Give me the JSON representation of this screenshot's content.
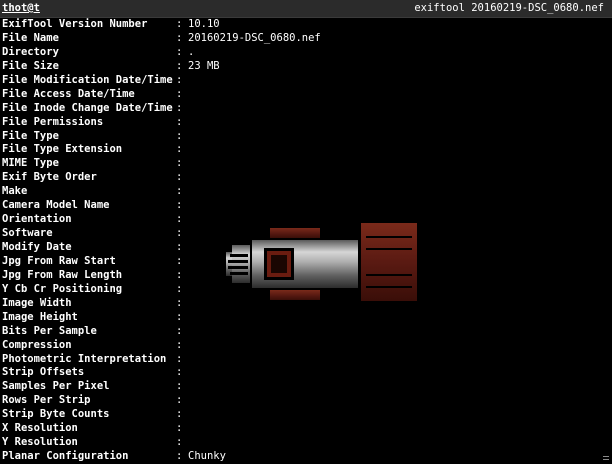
{
  "window": {
    "tab_label": "thot@t",
    "title": "exiftool 20160219-DSC_0680.nef"
  },
  "separator": ":",
  "rows": [
    {
      "key": "ExifTool Version Number",
      "value": "10.10"
    },
    {
      "key": "File Name",
      "value": "20160219-DSC_0680.nef"
    },
    {
      "key": "Directory",
      "value": "."
    },
    {
      "key": "File Size",
      "value": "23 MB"
    },
    {
      "key": "File Modification Date/Time",
      "value": ""
    },
    {
      "key": "File Access Date/Time",
      "value": ""
    },
    {
      "key": "File Inode Change Date/Time",
      "value": ""
    },
    {
      "key": "File Permissions",
      "value": ""
    },
    {
      "key": "File Type",
      "value": ""
    },
    {
      "key": "File Type Extension",
      "value": ""
    },
    {
      "key": "MIME Type",
      "value": ""
    },
    {
      "key": "Exif Byte Order",
      "value": ""
    },
    {
      "key": "Make",
      "value": ""
    },
    {
      "key": "Camera Model Name",
      "value": ""
    },
    {
      "key": "Orientation",
      "value": ""
    },
    {
      "key": "Software",
      "value": ""
    },
    {
      "key": "Modify Date",
      "value": ""
    },
    {
      "key": "Jpg From Raw Start",
      "value": ""
    },
    {
      "key": "Jpg From Raw Length",
      "value": ""
    },
    {
      "key": "Y Cb Cr Positioning",
      "value": ""
    },
    {
      "key": "Image Width",
      "value": ""
    },
    {
      "key": "Image Height",
      "value": ""
    },
    {
      "key": "Bits Per Sample",
      "value": ""
    },
    {
      "key": "Compression",
      "value": ""
    },
    {
      "key": "Photometric Interpretation",
      "value": ""
    },
    {
      "key": "Strip Offsets",
      "value": ""
    },
    {
      "key": "Samples Per Pixel",
      "value": ""
    },
    {
      "key": "Rows Per Strip",
      "value": ""
    },
    {
      "key": "Strip Byte Counts",
      "value": ""
    },
    {
      "key": "X Resolution",
      "value": ""
    },
    {
      "key": "Y Resolution",
      "value": ""
    },
    {
      "key": "Planar Configuration",
      "value": "Chunky"
    }
  ],
  "colors": {
    "background": "#000000",
    "text": "#ffffff",
    "titlebar": "#2b2b2b",
    "rocket_body": "#a8a8a8",
    "rocket_brown": "#5a1a12"
  },
  "icons": {
    "overlay": "pixel-rocket-icon",
    "corner": "resize-grip-icon"
  }
}
